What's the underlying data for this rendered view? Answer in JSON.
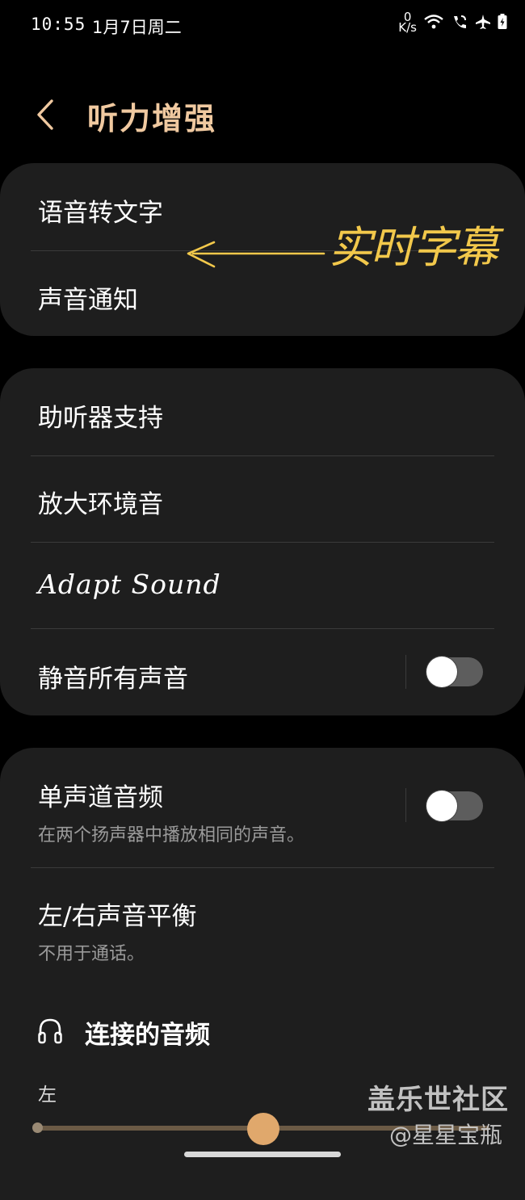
{
  "status_bar": {
    "time": "10:55",
    "date": "1月7日周二",
    "net_speed_value": "0",
    "net_speed_unit": "K/s"
  },
  "header": {
    "title": "听力增强"
  },
  "card1": {
    "item1": "语音转文字",
    "item2": "声音通知"
  },
  "annotation": {
    "text": "实时字幕",
    "color": "#f2c84b"
  },
  "card2": {
    "item1": "助听器支持",
    "item2": "放大环境音",
    "item3": "Adapt Sound",
    "item4": "静音所有声音",
    "item4_toggle_on": false
  },
  "card3": {
    "mono_title": "单声道音频",
    "mono_sub": "在两个扬声器中播放相同的声音。",
    "mono_toggle_on": false,
    "balance_title": "左/右声音平衡",
    "balance_sub": "不用于通话。",
    "connected_audio": "连接的音频",
    "left_label": "左",
    "balance_value_fraction": 0.5
  },
  "watermark": {
    "line1": "盖乐世社区",
    "line2": "@星星宝瓶"
  },
  "colors": {
    "accent": "#e0a86c",
    "title": "#f0c9a0",
    "card": "#1e1e1e"
  }
}
